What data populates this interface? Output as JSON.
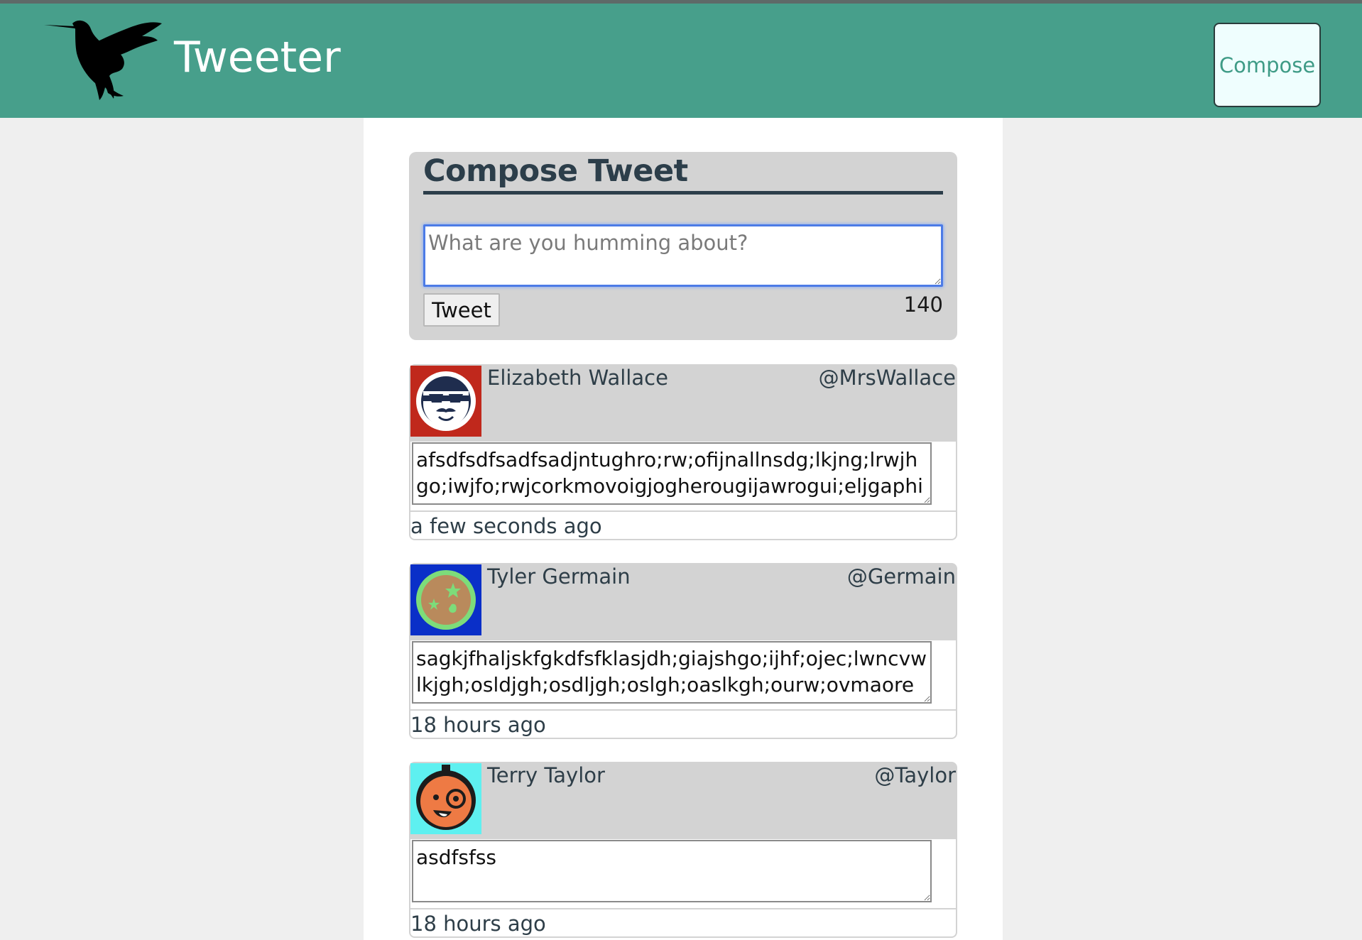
{
  "nav": {
    "brand": "Tweeter",
    "compose_label": "Compose"
  },
  "compose": {
    "title": "Compose Tweet",
    "placeholder": "What are you humming about?",
    "value": "",
    "submit_label": "Tweet",
    "counter": "140"
  },
  "tweets": [
    {
      "name": "Elizabeth Wallace",
      "handle": "@MrsWallace",
      "text": "afsdfsdfsadfsadjntughro;rw;ofijnallnsdg;lkjng;lrwjhgo;iwjfo;rwjcorkmovoigjogherougijawrogui;eljgaphiu;eoqjghilse",
      "time": "a few seconds ago",
      "avatar": "sunglasses-mustache-avatar"
    },
    {
      "name": "Tyler Germain",
      "handle": "@Germain",
      "text": "sagkjfhaljskfgkdfsfklasjdh;giajshgo;ijhf;ojec;lwncvwlkjgh;osldjgh;osdljgh;oslgh;oaslkgh;ourw;ovmaorewcoijwe;ow",
      "time": "18 hours ago",
      "avatar": "cookie-stars-avatar"
    },
    {
      "name": "Terry Taylor",
      "handle": "@Taylor",
      "text": "asdfsfss",
      "time": "18 hours ago",
      "avatar": "monocle-face-avatar"
    }
  ],
  "colors": {
    "navbar": "#479f8b",
    "page_bg": "#efefef",
    "panel": "#d3d3d3",
    "heading": "#2c3e4a",
    "focus": "#4c7be6"
  }
}
